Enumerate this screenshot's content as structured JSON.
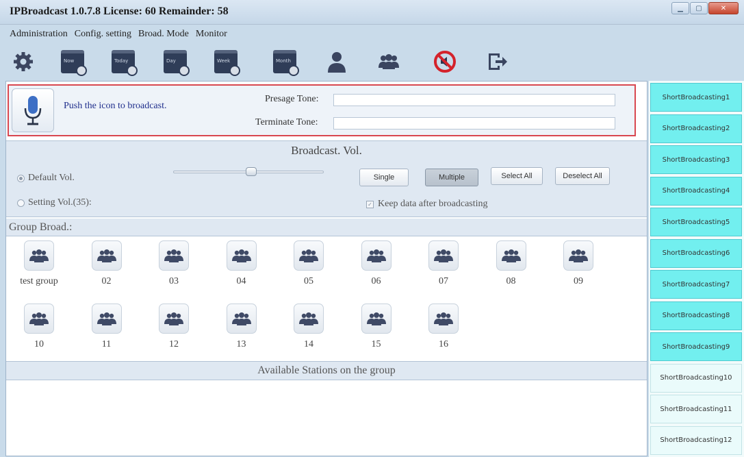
{
  "window": {
    "title": "IPBroadcast 1.0.7.8 License: 60 Remainder: 58",
    "controls": [
      "minimize-icon",
      "maximize-icon",
      "close-icon"
    ]
  },
  "menu": [
    "Administration",
    "Config. setting",
    "Broad. Mode",
    "Monitor"
  ],
  "toolbar": {
    "tools": [
      {
        "icon": "gear-icon"
      },
      {
        "icon": "calendar-now-icon",
        "label": "Now"
      },
      {
        "icon": "calendar-today-icon",
        "label": "Today"
      },
      {
        "icon": "calendar-day-icon",
        "label": "Day"
      },
      {
        "icon": "calendar-week-icon",
        "label": "Week"
      },
      {
        "icon": "calendar-month-icon",
        "label": "Month"
      },
      {
        "icon": "user-icon"
      },
      {
        "icon": "group-icon"
      },
      {
        "icon": "mute-icon"
      },
      {
        "icon": "exit-icon"
      }
    ]
  },
  "push": {
    "text": "Push the icon to broadcast.",
    "presage_label": "Presage Tone:",
    "presage_value": "",
    "terminate_label": "Terminate Tone:",
    "terminate_value": ""
  },
  "volume": {
    "header": "Broadcast. Vol.",
    "default_label": "Default Vol.",
    "setting_label": "Setting Vol.(35):",
    "selected": "default",
    "slider_level": 0.52,
    "buttons": {
      "single": "Single",
      "multiple": "Multiple",
      "select_all": "Select All",
      "deselect_all": "Deselect All"
    },
    "active_button": "multiple",
    "keep_label": "Keep data after broadcasting",
    "keep_checked": true
  },
  "groups": {
    "header": "Group Broad.:",
    "items": [
      "test group",
      "02",
      "03",
      "04",
      "05",
      "06",
      "07",
      "08",
      "09",
      "10",
      "11",
      "12",
      "13",
      "14",
      "15",
      "16"
    ]
  },
  "stations": {
    "header": "Available Stations on the group"
  },
  "short_broadcasts": [
    "ShortBroadcasting1",
    "ShortBroadcasting2",
    "ShortBroadcasting3",
    "ShortBroadcasting4",
    "ShortBroadcasting5",
    "ShortBroadcasting6",
    "ShortBroadcasting7",
    "ShortBroadcasting8",
    "ShortBroadcasting9",
    "ShortBroadcasting10",
    "ShortBroadcasting11",
    "ShortBroadcasting12"
  ],
  "colors": {
    "accent": "#72efef",
    "panel_border": "#d8474f",
    "link_text": "#1f2e8c"
  }
}
